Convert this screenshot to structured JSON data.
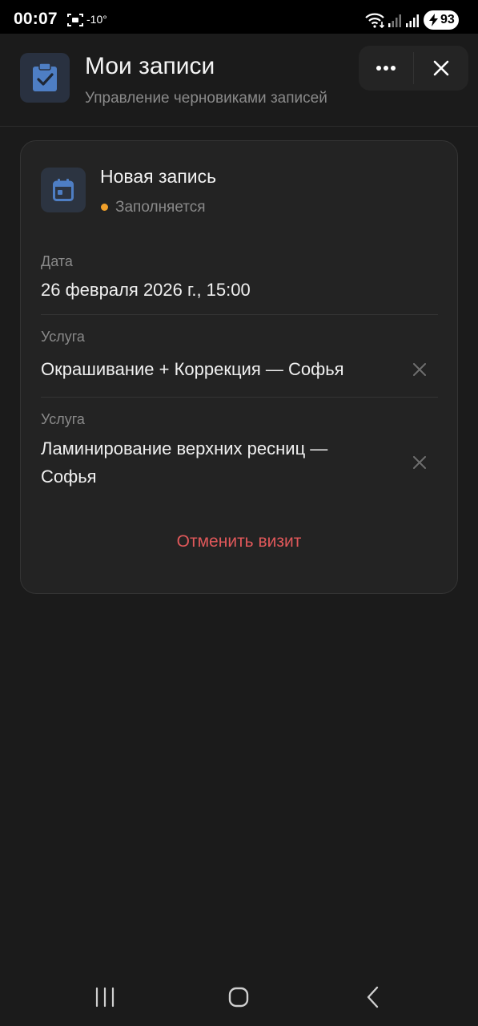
{
  "status_bar": {
    "time": "00:07",
    "temperature": "-10°",
    "battery": "93"
  },
  "header": {
    "title": "Мои записи",
    "subtitle": "Управление черновиками записей"
  },
  "card": {
    "title": "Новая запись",
    "status": "Заполняется",
    "status_color": "#f0a02a",
    "fields": [
      {
        "label": "Дата",
        "value": "26 февраля 2026 г., 15:00"
      },
      {
        "label": "Услуга",
        "value": "Окрашивание + Коррекция — Софья"
      },
      {
        "label": "Услуга",
        "value_lines": [
          "Ламинирование верхних ресниц —",
          "Софья"
        ]
      }
    ],
    "cancel_label": "Отменить визит",
    "cancel_color": "#e0585a"
  },
  "colors": {
    "background": "#1b1b1b",
    "card": "#232323",
    "accent": "#4e7ec4"
  },
  "icons": {
    "app": "clipboard-check-icon",
    "card": "calendar-icon",
    "more": "more-horizontal-icon",
    "close": "close-icon",
    "remove": "remove-icon"
  }
}
